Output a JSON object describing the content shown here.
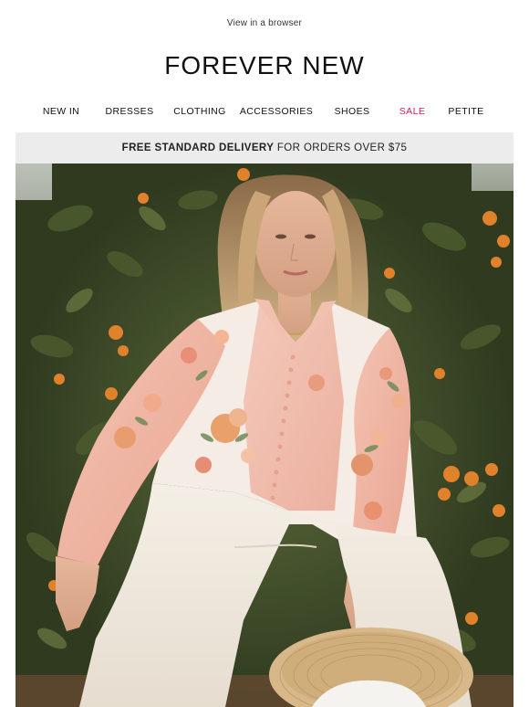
{
  "preheader": {
    "browser_link": "View in a browser"
  },
  "brand": {
    "logo_text": "FOREVER NEW"
  },
  "nav": {
    "items": [
      {
        "label": "NEW IN"
      },
      {
        "label": "DRESSES"
      },
      {
        "label": "CLOTHING"
      },
      {
        "label": "ACCESSORIES"
      },
      {
        "label": "SHOES"
      },
      {
        "label": "SALE"
      },
      {
        "label": "PETITE"
      }
    ]
  },
  "banner": {
    "bold_text": "FREE STANDARD DELIVERY",
    "rest_text": " FOR ORDERS OVER $75"
  },
  "colors": {
    "sale": "#d81b60",
    "banner_bg": "#ececec",
    "foliage": "#3f4a2a",
    "orange_fruit": "#e0812b",
    "blouse_pink": "#f1b9a8",
    "trousers": "#efe9de",
    "straw_hat": "#d8b888"
  }
}
